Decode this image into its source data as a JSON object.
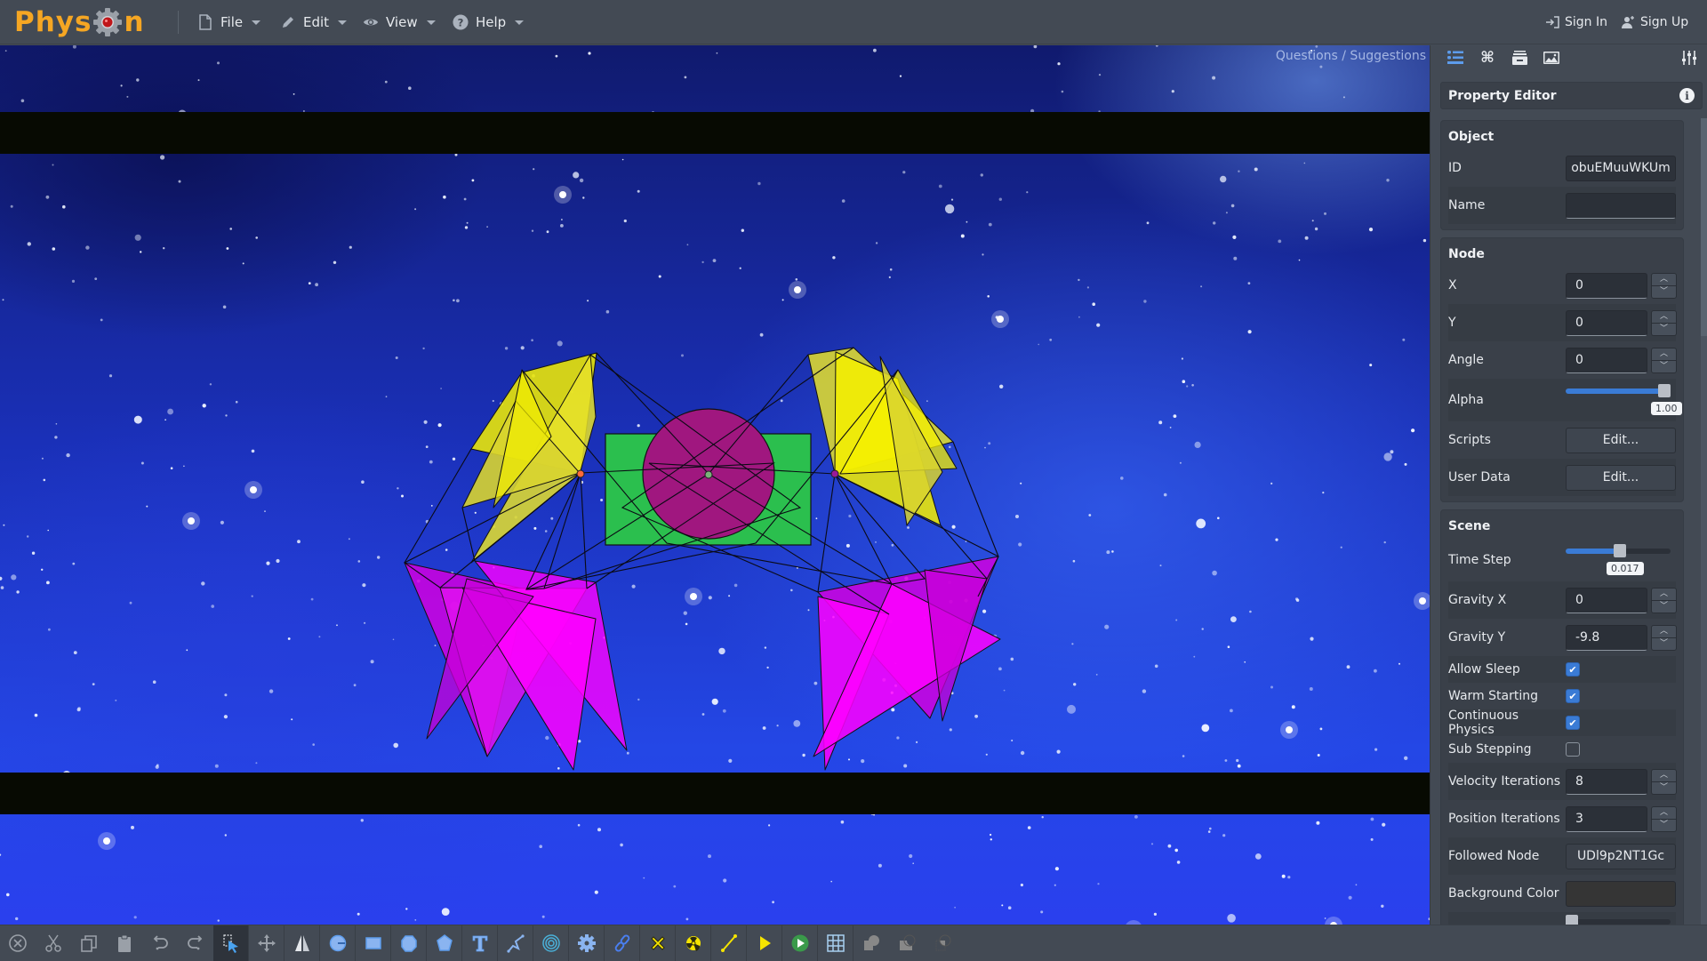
{
  "app": {
    "name": "Physion",
    "logo_text_left": "Phys",
    "logo_text_right": "n",
    "accent_color": "#f5a623"
  },
  "menubar": {
    "menus": [
      {
        "label": "File",
        "icon": "file-icon"
      },
      {
        "label": "Edit",
        "icon": "pencil-icon"
      },
      {
        "label": "View",
        "icon": "eye-icon"
      },
      {
        "label": "Help",
        "icon": "question-circle-icon"
      }
    ],
    "sign_in": "Sign In",
    "sign_up": "Sign Up"
  },
  "canvas": {
    "questions_link": "Questions / Suggestions",
    "scene": {
      "background": "space-starfield",
      "shapes": [
        {
          "type": "rectangle",
          "color": "#2bbf4e",
          "role": "body-bar"
        },
        {
          "type": "circle",
          "color": "#a0177f",
          "role": "body-center"
        },
        {
          "type": "polygon",
          "color": "#f5f000",
          "role": "left-wing-upper"
        },
        {
          "type": "polygon",
          "color": "#f5f000",
          "role": "right-wing-upper"
        },
        {
          "type": "polygon",
          "color": "#ff00ff",
          "role": "left-leg-lower"
        },
        {
          "type": "polygon",
          "color": "#ff00ff",
          "role": "right-leg-lower"
        }
      ]
    }
  },
  "panel": {
    "tabs": [
      {
        "name": "properties-tab-icon",
        "active": true
      },
      {
        "name": "command-tab-icon",
        "active": false
      },
      {
        "name": "archive-tab-icon",
        "active": false
      },
      {
        "name": "image-tab-icon",
        "active": false
      }
    ],
    "settings_icon": "sliders-icon",
    "title": "Property Editor",
    "info_glyph": "i",
    "object": {
      "title": "Object",
      "id_label": "ID",
      "id_value": "obuEMuuWKUm",
      "name_label": "Name",
      "name_value": ""
    },
    "node": {
      "title": "Node",
      "x_label": "X",
      "x_value": "0",
      "y_label": "Y",
      "y_value": "0",
      "angle_label": "Angle",
      "angle_value": "0",
      "alpha_label": "Alpha",
      "alpha_value": 1.0,
      "alpha_display": "1.00",
      "scripts_label": "Scripts",
      "scripts_button": "Edit...",
      "userdata_label": "User Data",
      "userdata_button": "Edit..."
    },
    "scene": {
      "title": "Scene",
      "timestep_label": "Time Step",
      "timestep_fraction": 0.52,
      "timestep_display": "0.017",
      "gravx_label": "Gravity X",
      "gravx_value": "0",
      "gravy_label": "Gravity Y",
      "gravy_value": "-9.8",
      "allow_sleep_label": "Allow Sleep",
      "allow_sleep": true,
      "warm_start_label": "Warm Starting",
      "warm_start": true,
      "continuous_label": "Continuous Physics",
      "continuous": true,
      "substep_label": "Sub Stepping",
      "substep": false,
      "vel_iter_label": "Velocity Iterations",
      "vel_iter_value": "8",
      "pos_iter_label": "Position Iterations",
      "pos_iter_value": "3",
      "followed_label": "Followed Node",
      "followed_value": "UDl9p2NT1Gc",
      "bgcolor_label": "Background Color",
      "bgcolor_value": "#353535"
    },
    "check_glyph": "✔",
    "spin_up": "︿",
    "spin_down": "﹀"
  },
  "toolbar": {
    "tools": [
      {
        "name": "delete-icon",
        "group": "edit"
      },
      {
        "name": "cut-icon",
        "group": "edit"
      },
      {
        "name": "copy-icon",
        "group": "edit"
      },
      {
        "name": "paste-icon",
        "group": "edit"
      },
      {
        "name": "undo-icon",
        "group": "edit"
      },
      {
        "name": "redo-icon",
        "group": "edit"
      },
      {
        "name": "select-tool-icon",
        "group": "mode",
        "active": true
      },
      {
        "name": "move-tool-icon",
        "group": "mode"
      },
      {
        "name": "mirror-tool-icon",
        "group": "mode"
      },
      {
        "name": "circle-tool-icon",
        "group": "shape"
      },
      {
        "name": "rectangle-tool-icon",
        "group": "shape"
      },
      {
        "name": "blob-tool-icon",
        "group": "shape"
      },
      {
        "name": "polygon-tool-icon",
        "group": "shape"
      },
      {
        "name": "text-tool-icon",
        "group": "shape"
      },
      {
        "name": "path-tool-icon",
        "group": "shape"
      },
      {
        "name": "spiral-tool-icon",
        "group": "shape"
      },
      {
        "name": "gear-tool-icon",
        "group": "shape"
      },
      {
        "name": "chain-tool-icon",
        "group": "shape"
      },
      {
        "name": "weld-joint-icon",
        "group": "joint"
      },
      {
        "name": "revolute-joint-icon",
        "group": "joint"
      },
      {
        "name": "distance-joint-icon",
        "group": "joint"
      },
      {
        "name": "prismatic-joint-icon",
        "group": "joint"
      },
      {
        "name": "play-icon",
        "group": "run"
      },
      {
        "name": "grid-icon",
        "group": "view"
      },
      {
        "name": "union-icon",
        "group": "boolean"
      },
      {
        "name": "subtract-icon",
        "group": "boolean"
      },
      {
        "name": "intersect-icon",
        "group": "boolean"
      }
    ]
  }
}
